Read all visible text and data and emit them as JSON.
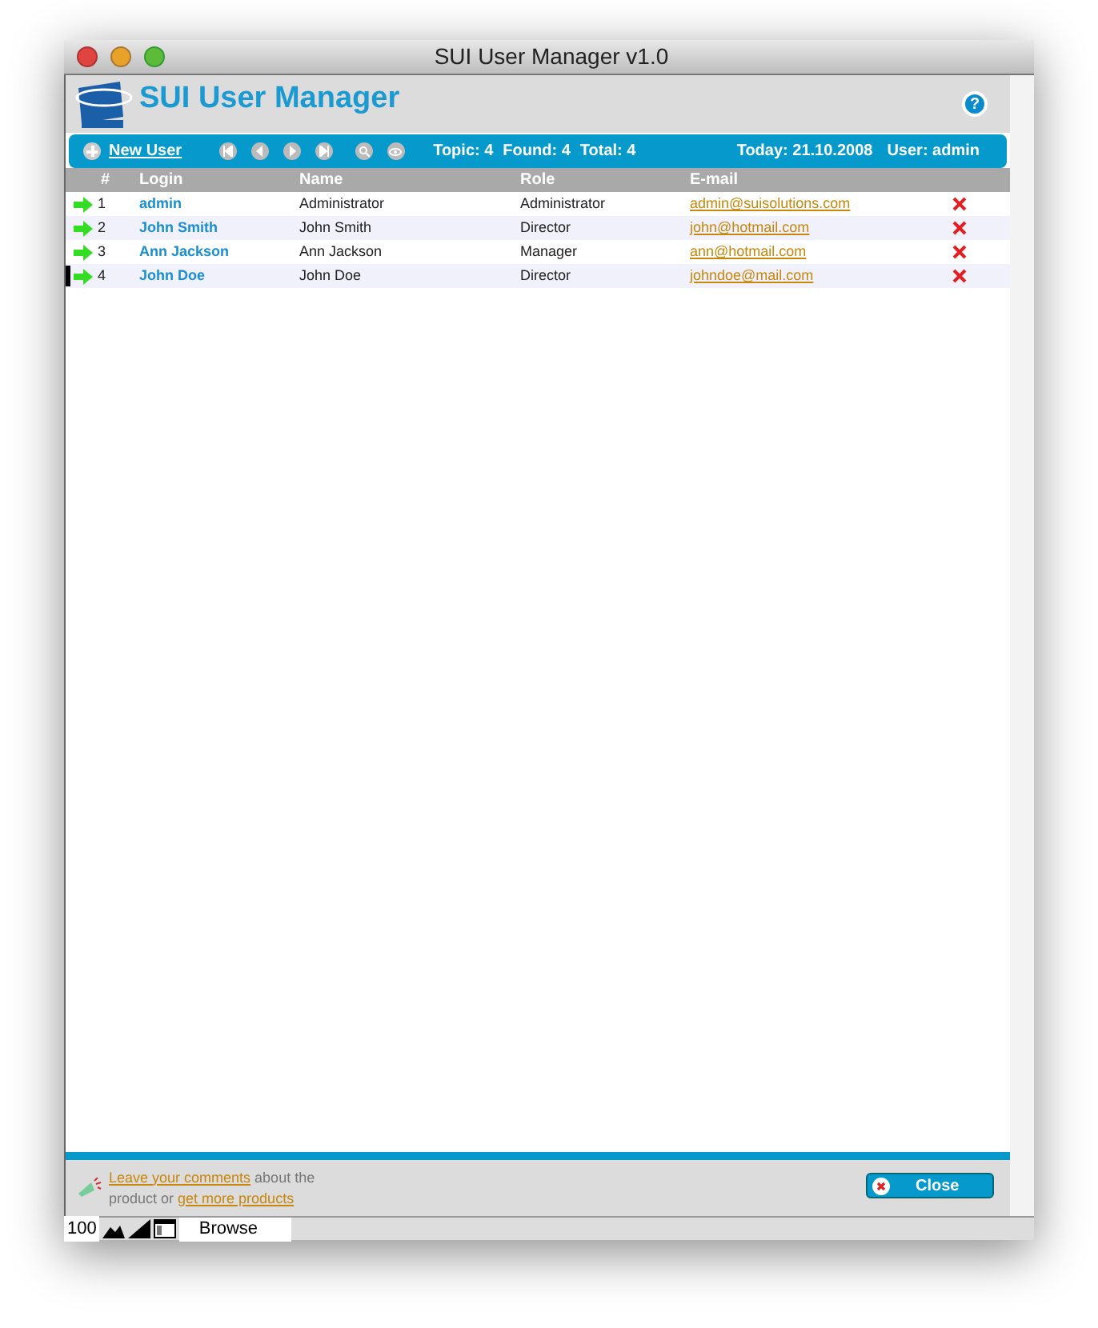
{
  "window": {
    "title": "SUI User Manager v1.0"
  },
  "app": {
    "title": "SUI User Manager",
    "help": "?"
  },
  "toolbar": {
    "new_user": "New User",
    "stats": [
      "Topic: 4",
      "Found: 4",
      "Total: 4"
    ],
    "today": "Today: 21.10.2008",
    "user": "User: admin"
  },
  "table": {
    "columns": [
      "#",
      "Login",
      "Name",
      "Role",
      "E-mail"
    ],
    "rows": [
      {
        "number": "1",
        "login": "admin",
        "name": "Administrator",
        "role": "Administrator",
        "email": "admin@suisolutions.com",
        "selected": false
      },
      {
        "number": "2",
        "login": "John Smith",
        "name": "John Smith",
        "role": "Director",
        "email": "john@hotmail.com",
        "selected": false
      },
      {
        "number": "3",
        "login": "Ann Jackson",
        "name": "Ann Jackson",
        "role": "Manager",
        "email": "ann@hotmail.com",
        "selected": false
      },
      {
        "number": "4",
        "login": "John Doe",
        "name": "John Doe",
        "role": "Director",
        "email": "johndoe@mail.com",
        "selected": true
      }
    ]
  },
  "footer": {
    "link_1": "Leave your comments",
    "text_1": "about",
    "text_2": "the product or",
    "link_2": "get more products",
    "close": "Close"
  },
  "status_bar": {
    "zoom": "100",
    "mode": "Browse"
  }
}
